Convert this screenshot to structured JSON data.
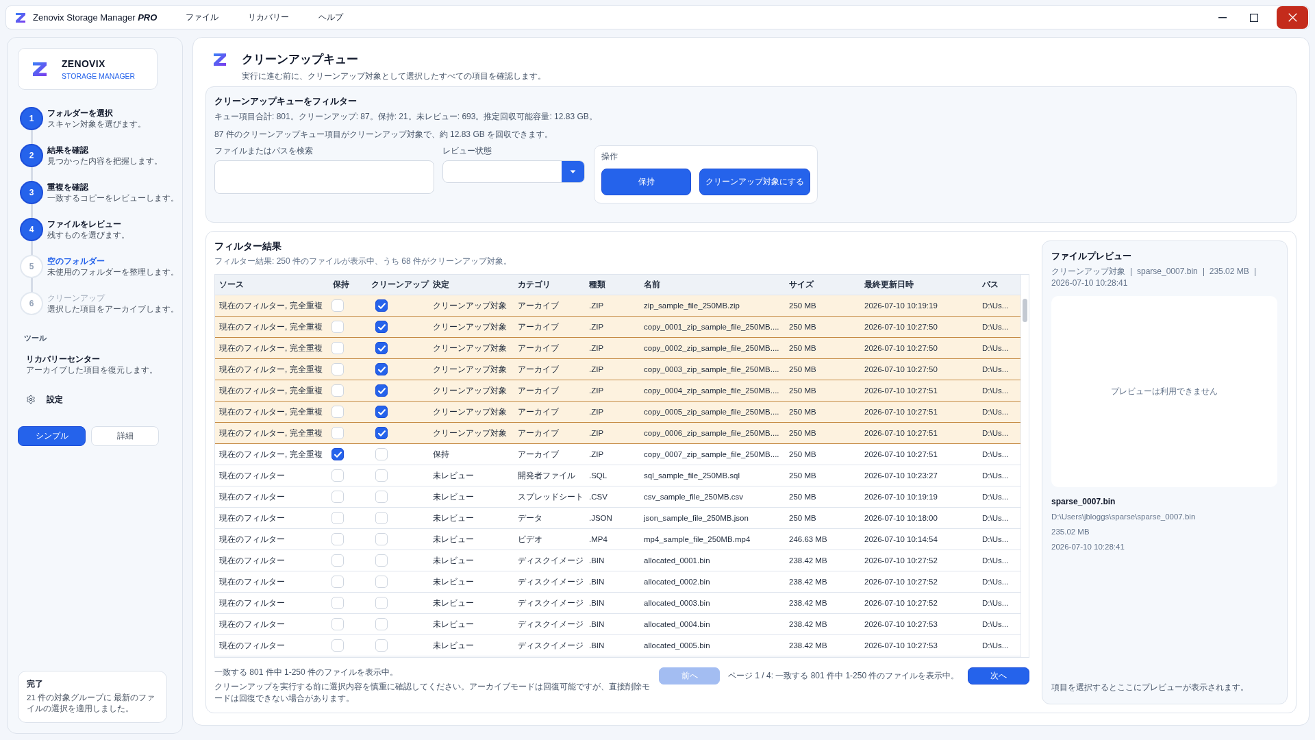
{
  "window": {
    "title": "Zenovix Storage Manager *PRO*",
    "menu": [
      "ファイル",
      "リカバリー",
      "ヘルプ"
    ]
  },
  "sidebar": {
    "brand": {
      "name": "ZENOVIX",
      "tagline": "STORAGE MANAGER"
    },
    "steps": [
      {
        "number": "1",
        "title": "フォルダーを選択",
        "description": "スキャン対象を選びます。",
        "done": true,
        "selected": false
      },
      {
        "number": "2",
        "title": "結果を確認",
        "description": "見つかった内容を把握します。",
        "done": true,
        "selected": false
      },
      {
        "number": "3",
        "title": "重複を確認",
        "description": "一致するコピーをレビューします。",
        "done": true,
        "selected": false
      },
      {
        "number": "4",
        "title": "ファイルをレビュー",
        "description": "残すものを選びます。",
        "done": true,
        "selected": false
      },
      {
        "number": "5",
        "title": "空のフォルダー",
        "description": "未使用のフォルダーを整理します。",
        "done": false,
        "selected": true
      },
      {
        "number": "6",
        "title": "クリーンアップ",
        "description": "選択した項目をアーカイブします。",
        "done": false,
        "selected": false
      }
    ],
    "tools_heading": "ツール",
    "tools": [
      {
        "title": "リカバリーセンター",
        "description": "アーカイブした項目を復元します。"
      }
    ],
    "settings": "設定",
    "modes": [
      {
        "label": "シンプル",
        "selected": true
      },
      {
        "label": "詳細",
        "selected": false
      }
    ],
    "notice": {
      "title": "完了",
      "text": "21 件の対象グループに 最新のファイルの選択を適用しました。"
    }
  },
  "header": {
    "title": "クリーンアップキュー",
    "subtitle": "実行に進む前に、クリーンアップ対象として選択したすべての項目を確認します。"
  },
  "filter": {
    "title": "クリーンアップキューをフィルター",
    "summary": "キュー項目合計: 801。クリーンアップ: 87。保持: 21。未レビュー: 693。推定回収可能容量: 12.83 GB。",
    "note": "87 件のクリーンアップキュー項目がクリーンアップ対象で、約 12.83 GB を回収できます。",
    "search": {
      "label": "ファイルまたはパスを検索"
    },
    "review_status": {
      "label": "レビュー状態"
    },
    "actions": {
      "label": "操作",
      "buttons": [
        "保持",
        "クリーンアップ対象にする"
      ]
    }
  },
  "results": {
    "title": "フィルター結果",
    "subtitle": "フィルター結果: 250 件のファイルが表示中、うち 68 件がクリーンアップ対象。",
    "table": {
      "columns": [
        "ソース",
        "保持",
        "クリーンアップ",
        "決定",
        "カテゴリ",
        "種類",
        "名前",
        "サイズ",
        "最終更新日時",
        "パス"
      ],
      "rows": [
        {
          "source": "現在のフィルター, 完全重複",
          "keep": false,
          "cleanup": true,
          "decision": "クリーンアップ対象",
          "category": "アーカイブ",
          "type": ".ZIP",
          "name": "zip_sample_file_250MB.zip",
          "size": "250 MB",
          "modified": "2026-07-10 10:19:19",
          "path": "D:\\Us..."
        },
        {
          "source": "現在のフィルター, 完全重複",
          "keep": false,
          "cleanup": true,
          "decision": "クリーンアップ対象",
          "category": "アーカイブ",
          "type": ".ZIP",
          "name": "copy_0001_zip_sample_file_250MB....",
          "size": "250 MB",
          "modified": "2026-07-10 10:27:50",
          "path": "D:\\Us..."
        },
        {
          "source": "現在のフィルター, 完全重複",
          "keep": false,
          "cleanup": true,
          "decision": "クリーンアップ対象",
          "category": "アーカイブ",
          "type": ".ZIP",
          "name": "copy_0002_zip_sample_file_250MB....",
          "size": "250 MB",
          "modified": "2026-07-10 10:27:50",
          "path": "D:\\Us..."
        },
        {
          "source": "現在のフィルター, 完全重複",
          "keep": false,
          "cleanup": true,
          "decision": "クリーンアップ対象",
          "category": "アーカイブ",
          "type": ".ZIP",
          "name": "copy_0003_zip_sample_file_250MB....",
          "size": "250 MB",
          "modified": "2026-07-10 10:27:50",
          "path": "D:\\Us..."
        },
        {
          "source": "現在のフィルター, 完全重複",
          "keep": false,
          "cleanup": true,
          "decision": "クリーンアップ対象",
          "category": "アーカイブ",
          "type": ".ZIP",
          "name": "copy_0004_zip_sample_file_250MB....",
          "size": "250 MB",
          "modified": "2026-07-10 10:27:51",
          "path": "D:\\Us..."
        },
        {
          "source": "現在のフィルター, 完全重複",
          "keep": false,
          "cleanup": true,
          "decision": "クリーンアップ対象",
          "category": "アーカイブ",
          "type": ".ZIP",
          "name": "copy_0005_zip_sample_file_250MB....",
          "size": "250 MB",
          "modified": "2026-07-10 10:27:51",
          "path": "D:\\Us..."
        },
        {
          "source": "現在のフィルター, 完全重複",
          "keep": false,
          "cleanup": true,
          "decision": "クリーンアップ対象",
          "category": "アーカイブ",
          "type": ".ZIP",
          "name": "copy_0006_zip_sample_file_250MB....",
          "size": "250 MB",
          "modified": "2026-07-10 10:27:51",
          "path": "D:\\Us..."
        },
        {
          "source": "現在のフィルター, 完全重複",
          "keep": true,
          "cleanup": false,
          "decision": "保持",
          "category": "アーカイブ",
          "type": ".ZIP",
          "name": "copy_0007_zip_sample_file_250MB....",
          "size": "250 MB",
          "modified": "2026-07-10 10:27:51",
          "path": "D:\\Us..."
        },
        {
          "source": "現在のフィルター",
          "keep": false,
          "cleanup": false,
          "decision": "未レビュー",
          "category": "開発者ファイル",
          "type": ".SQL",
          "name": "sql_sample_file_250MB.sql",
          "size": "250 MB",
          "modified": "2026-07-10 10:23:27",
          "path": "D:\\Us..."
        },
        {
          "source": "現在のフィルター",
          "keep": false,
          "cleanup": false,
          "decision": "未レビュー",
          "category": "スプレッドシート",
          "type": ".CSV",
          "name": "csv_sample_file_250MB.csv",
          "size": "250 MB",
          "modified": "2026-07-10 10:19:19",
          "path": "D:\\Us..."
        },
        {
          "source": "現在のフィルター",
          "keep": false,
          "cleanup": false,
          "decision": "未レビュー",
          "category": "データ",
          "type": ".JSON",
          "name": "json_sample_file_250MB.json",
          "size": "250 MB",
          "modified": "2026-07-10 10:18:00",
          "path": "D:\\Us..."
        },
        {
          "source": "現在のフィルター",
          "keep": false,
          "cleanup": false,
          "decision": "未レビュー",
          "category": "ビデオ",
          "type": ".MP4",
          "name": "mp4_sample_file_250MB.mp4",
          "size": "246.63 MB",
          "modified": "2026-07-10 10:14:54",
          "path": "D:\\Us..."
        },
        {
          "source": "現在のフィルター",
          "keep": false,
          "cleanup": false,
          "decision": "未レビュー",
          "category": "ディスクイメージ",
          "type": ".BIN",
          "name": "allocated_0001.bin",
          "size": "238.42 MB",
          "modified": "2026-07-10 10:27:52",
          "path": "D:\\Us..."
        },
        {
          "source": "現在のフィルター",
          "keep": false,
          "cleanup": false,
          "decision": "未レビュー",
          "category": "ディスクイメージ",
          "type": ".BIN",
          "name": "allocated_0002.bin",
          "size": "238.42 MB",
          "modified": "2026-07-10 10:27:52",
          "path": "D:\\Us..."
        },
        {
          "source": "現在のフィルター",
          "keep": false,
          "cleanup": false,
          "decision": "未レビュー",
          "category": "ディスクイメージ",
          "type": ".BIN",
          "name": "allocated_0003.bin",
          "size": "238.42 MB",
          "modified": "2026-07-10 10:27:52",
          "path": "D:\\Us..."
        },
        {
          "source": "現在のフィルター",
          "keep": false,
          "cleanup": false,
          "decision": "未レビュー",
          "category": "ディスクイメージ",
          "type": ".BIN",
          "name": "allocated_0004.bin",
          "size": "238.42 MB",
          "modified": "2026-07-10 10:27:53",
          "path": "D:\\Us..."
        },
        {
          "source": "現在のフィルター",
          "keep": false,
          "cleanup": false,
          "decision": "未レビュー",
          "category": "ディスクイメージ",
          "type": ".BIN",
          "name": "allocated_0005.bin",
          "size": "238.42 MB",
          "modified": "2026-07-10 10:27:53",
          "path": "D:\\Us..."
        }
      ]
    },
    "range": "一致する 801 件中 1-250 件のファイルを表示中。",
    "warning": "クリーンアップを実行する前に選択内容を慎重に確認してください。アーカイブモードは回復可能ですが、直接削除モードは回復できない場合があります。",
    "pagination": {
      "previous": {
        "label": "前へ",
        "disabled": true
      },
      "page_info": "ページ 1 / 4: 一致する 801 件中 1-250 件のファイルを表示中。",
      "next": {
        "label": "次へ",
        "disabled": false
      }
    }
  },
  "preview": {
    "title": "ファイルプレビュー",
    "meta": [
      "クリーンアップ対象",
      "sparse_0007.bin",
      "235.02 MB",
      "2026-07-10 10:28:41"
    ],
    "empty_message": "プレビューは利用できません",
    "file_name": "sparse_0007.bin",
    "path": "D:\\Users\\jbloggs\\sparse\\sparse_0007.bin",
    "size": "235.02 MB",
    "modified": "2026-07-10 10:28:41",
    "hint": "項目を選択するとここにプレビューが表示されます。"
  }
}
